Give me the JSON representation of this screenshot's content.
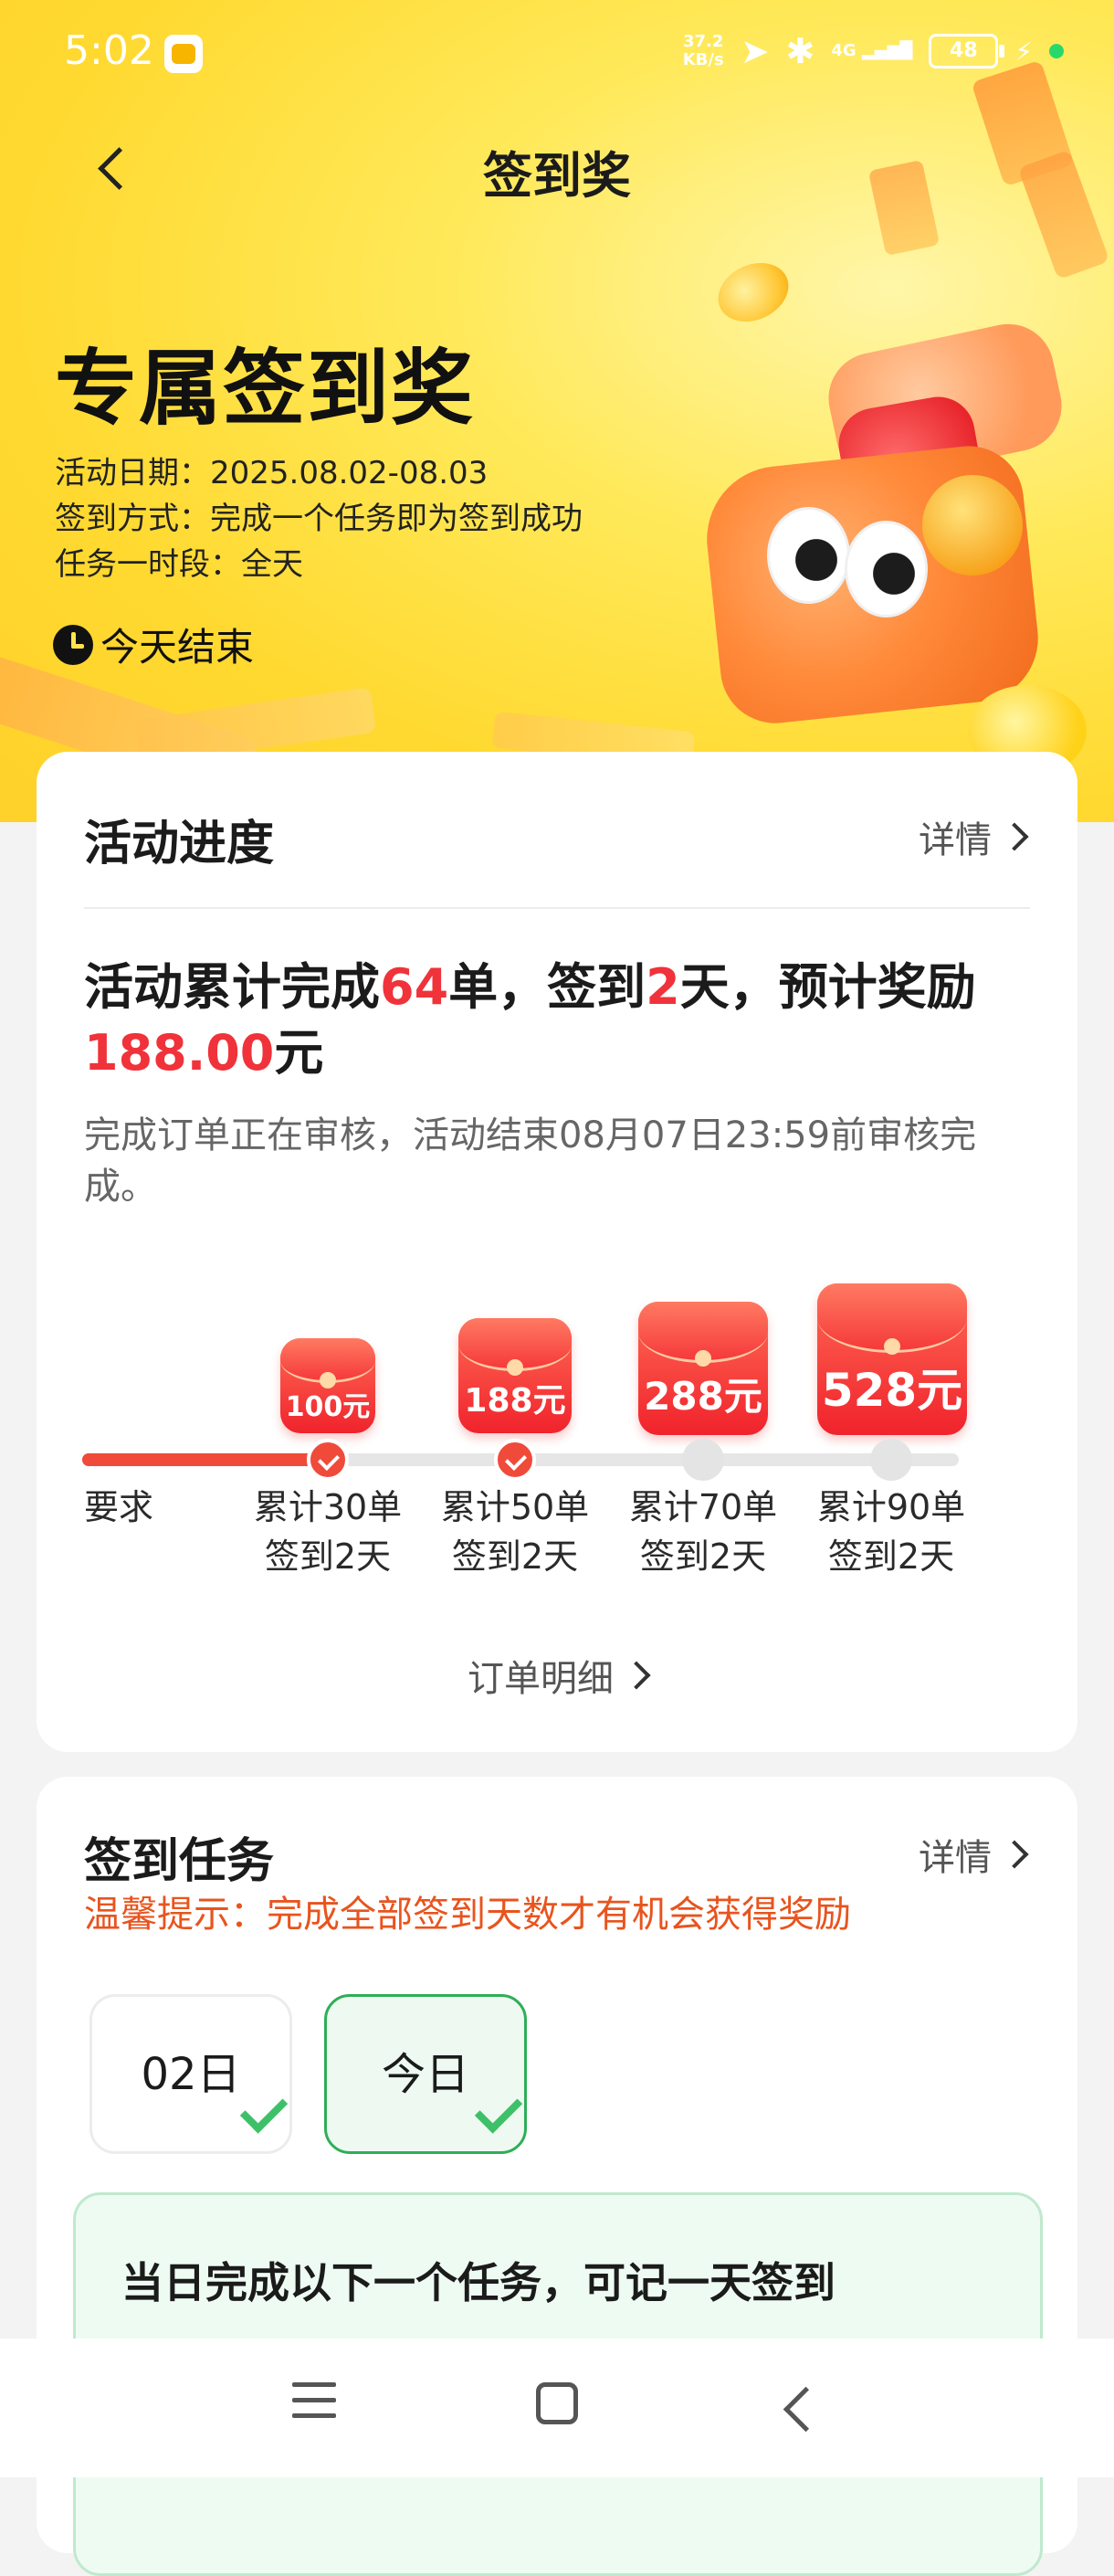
{
  "status_bar": {
    "time": "5:02",
    "net_speed_top": "37.2",
    "net_speed_bottom": "KB/s",
    "signal_label": "4G",
    "battery": "48"
  },
  "nav": {
    "title": "签到奖"
  },
  "hero": {
    "title": "专属签到奖",
    "date_line": "活动日期：2025.08.02-08.03",
    "method_line": "签到方式：完成一个任务即为签到成功",
    "period_line": "任务一时段：全天",
    "ends": "今天结束"
  },
  "progress_card": {
    "title": "活动进度",
    "detail": "详情",
    "summary_prefix": "活动累计完成",
    "orders": "64",
    "summary_mid1": "单，签到",
    "days": "2",
    "summary_mid2": "天，预计奖励",
    "reward": "188.00",
    "reward_unit": "元",
    "note": "完成订单正在审核，活动结束08月07日23:59前审核完成。",
    "progress_fraction": 0.3,
    "milestones": [
      {
        "label": "要求",
        "amount": "",
        "done": false,
        "partial": true
      },
      {
        "line1": "累计30单",
        "line2": "签到2天",
        "amount": "100元",
        "done": true
      },
      {
        "line1": "累计50单",
        "line2": "签到2天",
        "amount": "188元",
        "done": true
      },
      {
        "line1": "累计70单",
        "line2": "签到2天",
        "amount": "288元",
        "done": false
      },
      {
        "line1": "累计90单",
        "line2": "签到2天",
        "amount": "528元",
        "done": false
      }
    ],
    "orders_link": "订单明细"
  },
  "signin_card": {
    "title": "签到任务",
    "detail": "详情",
    "tip": "温馨提示：完成全部签到天数才有机会获得奖励",
    "days": [
      {
        "label": "02日",
        "checked": true
      },
      {
        "label": "今日",
        "checked": true
      }
    ],
    "task_text": "当日完成以下一个任务，可记一天签到"
  },
  "colors": {
    "accent_red": "#f0323a",
    "hero_yellow": "#ffd930",
    "green": "#2fae58",
    "tip_orange": "#e8541e"
  }
}
